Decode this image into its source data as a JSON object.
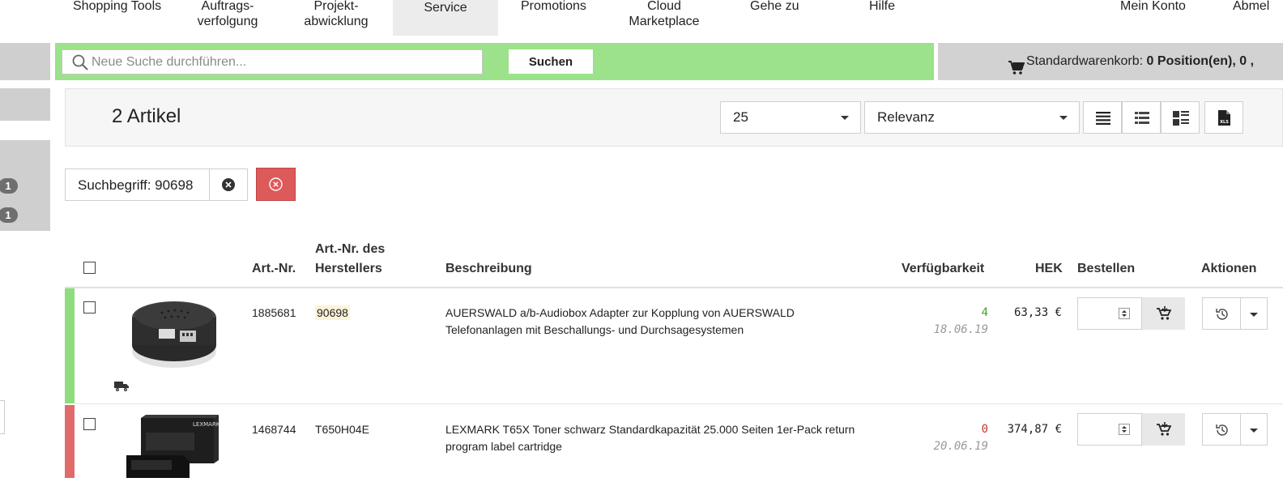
{
  "nav": {
    "items": [
      {
        "label": "Shopping Tools"
      },
      {
        "label": "Auftrags-\nverfolgung"
      },
      {
        "label": "Projekt-\nabwicklung"
      },
      {
        "label": "Service"
      },
      {
        "label": "Promotions"
      },
      {
        "label": "Cloud\nMarketplace"
      },
      {
        "label": "Gehe zu"
      },
      {
        "label": "Hilfe"
      },
      {
        "label": "Mein Konto"
      },
      {
        "label": "Abmel"
      }
    ],
    "active": "Service"
  },
  "sidebar": {
    "badges": [
      "1",
      "1"
    ]
  },
  "search": {
    "placeholder": "Neue Suche durchführen...",
    "value": "",
    "button_label": "Suchen",
    "icon": "search-icon"
  },
  "cart": {
    "icon": "shopping-cart-icon",
    "label": "Standardwarenkorb:",
    "summary": "0 Position(en), 0 ,"
  },
  "toolbar": {
    "count_label": "2 Artikel",
    "per_page": "25",
    "sort": "Relevanz",
    "view_icons": [
      "list-view-icon",
      "detail-list-view-icon",
      "grid-view-icon",
      "xls-export-icon"
    ]
  },
  "filter": {
    "chip_label": "Suchbegriff: 90698",
    "colors": {
      "reset": "#dd5a5a",
      "search_bar": "#9be28a"
    }
  },
  "table": {
    "headers": {
      "artnr": "Art.-Nr.",
      "mfr_line1": "Art.-Nr. des",
      "mfr_line2": "Herstellers",
      "desc": "Beschreibung",
      "avail": "Verfügbarkeit",
      "hek": "HEK",
      "order": "Bestellen",
      "actions": "Aktionen"
    },
    "rows": [
      {
        "artnr": "1885681",
        "mfr": "90698",
        "desc": "AUERSWALD a/b-Audiobox Adapter zur Kopplung von AUERSWALD Telefonanlagen mit Beschallungs- und Durchsagesystemen",
        "stock": "4",
        "stock_color": "#4aa02c",
        "date": "18.06.19",
        "price": "63,33 €",
        "bar_color": "#8fdc7c",
        "shipping_icon": "truck-icon"
      },
      {
        "artnr": "1468744",
        "mfr": "T650H04E",
        "desc": "LEXMARK T65X Toner schwarz Standardkapazität 25.000 Seiten 1er-Pack return program label cartridge",
        "stock": "0",
        "stock_color": "#c0392b",
        "date": "20.06.19",
        "price": "374,87 €",
        "bar_color": "#e06b6b"
      }
    ]
  }
}
